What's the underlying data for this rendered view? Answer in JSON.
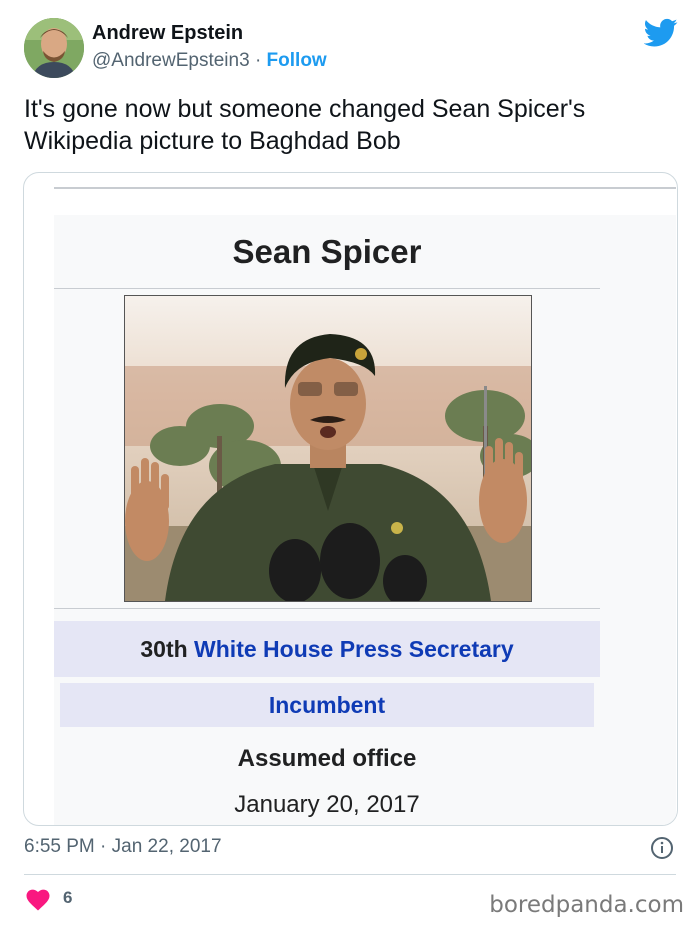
{
  "author": {
    "name": "Andrew Epstein",
    "handle": "@AndrewEpstein3",
    "separator": "·",
    "follow_label": "Follow"
  },
  "tweet": {
    "text": "It's gone now but someone changed Sean Spicer's Wikipedia picture to Baghdad Bob"
  },
  "infobox": {
    "name": "Sean Spicer",
    "office_ordinal": "30th",
    "office_link": "White House Press Secretary",
    "status": "Incumbent",
    "assumed_label": "Assumed office",
    "assumed_date": "January 20, 2017"
  },
  "footer": {
    "timestamp": "6:55 PM · Jan 22, 2017",
    "likes": "6",
    "watermark": "boredpanda.com"
  },
  "colors": {
    "twitter_blue": "#1d9bf0",
    "like_pink": "#f91880",
    "wiki_link": "#0f3bb5",
    "infobox_header_bg": "#e5e6f5"
  },
  "icons": {
    "brand": "twitter-bird-icon",
    "info": "info-circle-icon",
    "like": "heart-icon"
  }
}
